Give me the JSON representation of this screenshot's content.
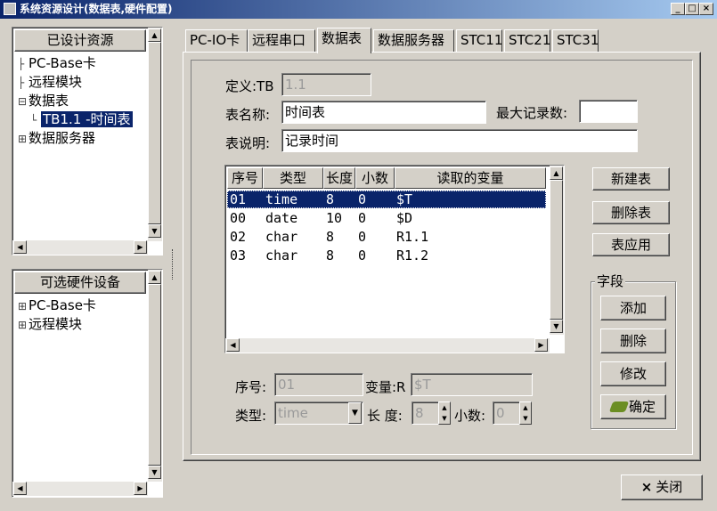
{
  "window": {
    "title": "系统资源设计(数据表,硬件配置)",
    "minimize": "_",
    "maximize": "□",
    "close": "×"
  },
  "designed": {
    "header": "已设计资源",
    "items": [
      {
        "prefix": "├",
        "label": "PC-Base卡"
      },
      {
        "prefix": "├",
        "label": "远程模块"
      },
      {
        "prefix": "⊟",
        "label": "数据表"
      },
      {
        "prefix": "└",
        "label": "TB1.1 -时间表",
        "selected": true
      },
      {
        "prefix": "⊞",
        "label": "数据服务器"
      }
    ]
  },
  "hardware": {
    "header": "可选硬件设备",
    "items": [
      {
        "prefix": "⊞",
        "label": "PC-Base卡"
      },
      {
        "prefix": "⊞",
        "label": "远程模块"
      }
    ]
  },
  "tabs": [
    {
      "label": "PC-IO卡"
    },
    {
      "label": "远程串口"
    },
    {
      "label": "数据表",
      "active": true
    },
    {
      "label": "数据服务器"
    },
    {
      "label": "STC11"
    },
    {
      "label": "STC21"
    },
    {
      "label": "STC31"
    }
  ],
  "form": {
    "def_label": "定义:TB",
    "def_value": "1.1",
    "name_label": "表名称:",
    "name_value": "时间表",
    "max_label": "最大记录数:",
    "max_value": "",
    "desc_label": "表说明:",
    "desc_value": "记录时间"
  },
  "table": {
    "headers": [
      "序号",
      "类型",
      "长度",
      "小数",
      "读取的变量"
    ],
    "rows": [
      {
        "seq": "01",
        "type": "time",
        "len": "8",
        "dec": "0",
        "var": "$T"
      },
      {
        "seq": "00",
        "type": "date",
        "len": "10",
        "dec": "0",
        "var": "$D"
      },
      {
        "seq": "02",
        "type": "char",
        "len": "8",
        "dec": "0",
        "var": "R1.1"
      },
      {
        "seq": "03",
        "type": "char",
        "len": "8",
        "dec": "0",
        "var": "R1.2"
      }
    ]
  },
  "buttons": {
    "new_table": "新建表",
    "delete_table": "删除表",
    "apply_table": "表应用",
    "close": "关闭",
    "close_mark": "×"
  },
  "field_group": {
    "title": "字段",
    "add": "添加",
    "delete": "删除",
    "modify": "修改",
    "confirm": "确定"
  },
  "detail": {
    "seq_label": "序号:",
    "seq_value": "01",
    "var_label": "变量:R",
    "var_value": "$T",
    "type_label": "类型:",
    "type_value": "time",
    "len_label": "长 度:",
    "len_value": "8",
    "dec_label": "小数:",
    "dec_value": "0"
  }
}
